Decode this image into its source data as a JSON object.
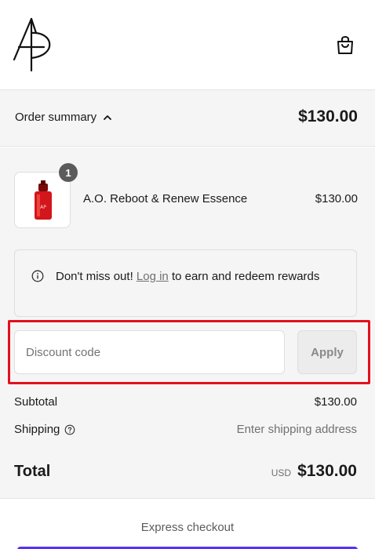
{
  "header": {
    "logo_text": "AP",
    "bag_icon": "shopping-bag-icon"
  },
  "summary_bar": {
    "toggle_label": "Order summary",
    "toggle_icon": "chevron-up-icon",
    "total": "$130.00"
  },
  "cart": {
    "items": [
      {
        "name": "A.O. Reboot & Renew Essence",
        "price": "$130.00",
        "quantity": "1"
      }
    ]
  },
  "rewards": {
    "icon": "info-icon",
    "text_before": "Don't miss out! ",
    "link_text": "Log in",
    "text_after": " to earn and redeem rewards"
  },
  "discount": {
    "placeholder": "Discount code",
    "value": "",
    "apply_label": "Apply"
  },
  "totals": {
    "subtotal_label": "Subtotal",
    "subtotal_value": "$130.00",
    "shipping_label": "Shipping",
    "shipping_value": "Enter shipping address",
    "total_label": "Total",
    "currency": "USD",
    "total_value": "$130.00"
  },
  "express": {
    "label": "Express checkout"
  },
  "colors": {
    "highlight": "#e3101d",
    "express_button": "#5a31f4",
    "summary_background": "#f5f5f5"
  }
}
